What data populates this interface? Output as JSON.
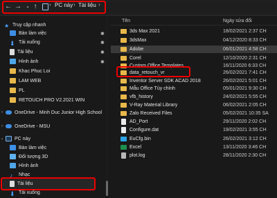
{
  "address": {
    "back_icon": "arrow-left-icon",
    "forward_icon": "arrow-right-icon",
    "recent_icon": "chevron-down-icon",
    "up_icon": "arrow-up-icon",
    "crumbs": [
      "PC này",
      "Tài liệu"
    ]
  },
  "nav": {
    "items": [
      {
        "label": "Truy cập nhanh",
        "icon": "star-icon"
      },
      {
        "label": "Bàn làm việc",
        "icon": "desktop-icon"
      },
      {
        "label": "Tải xuống",
        "icon": "download-icon"
      },
      {
        "label": "Tài liệu",
        "icon": "document-icon"
      },
      {
        "label": "Hình ảnh",
        "icon": "pictures-icon"
      },
      {
        "label": "Khac Phuc Loi",
        "icon": "folder-icon"
      },
      {
        "label": "LAM WEB",
        "icon": "folder-icon"
      },
      {
        "label": "PL",
        "icon": "folder-icon"
      },
      {
        "label": "RETOUCH PRO V2.2021 WIN",
        "icon": "folder-icon"
      },
      {
        "label": "OneDrive - Minh Duc Junior High School",
        "icon": "cloud-icon"
      },
      {
        "label": "OneDrive - MSU",
        "icon": "cloud-icon"
      },
      {
        "label": "PC này",
        "icon": "pc-icon"
      },
      {
        "label": "Bàn làm việc",
        "icon": "desktop-icon"
      },
      {
        "label": "Đối tượng 3D",
        "icon": "cube-icon"
      },
      {
        "label": "Hình ảnh",
        "icon": "pictures-icon"
      },
      {
        "label": "Nhạc",
        "icon": "music-icon"
      },
      {
        "label": "Tài liệu",
        "icon": "document-icon"
      },
      {
        "label": "Tải xuống",
        "icon": "download-icon"
      }
    ]
  },
  "columns": {
    "name": "Tên",
    "date": "Ngày sửa đổi"
  },
  "files": [
    {
      "name": "3ds Max 2021",
      "date": "18/02/2021 2:37 CH"
    },
    {
      "name": "3dsMax",
      "date": "04/12/2020 8:33 CH"
    },
    {
      "name": "Adobe",
      "date": "06/01/2021 4:58 CH"
    },
    {
      "name": "Corel",
      "date": "12/10/2020 2:31 CH"
    },
    {
      "name": "Custom Office Templates",
      "date": "16/11/2020 6:33 CH"
    },
    {
      "name": "data_retouch_vr",
      "date": "26/02/2021 7:41 CH"
    },
    {
      "name": "Inventor Server SDK ACAD 2018",
      "date": "26/02/2021 5:01 CH"
    },
    {
      "name": "Mẫu Office Tùy chỉnh",
      "date": "05/01/2021 9:30 CH"
    },
    {
      "name": "vfb_history",
      "date": "24/02/2021 5:55 CH"
    },
    {
      "name": "V-Ray Material Library",
      "date": "06/02/2021 2:05 CH"
    },
    {
      "name": "Zalo Received Files",
      "date": "05/02/2021 10:35 SA"
    },
    {
      "name": "AD_Port",
      "date": "29/11/2020 2:02 CH"
    },
    {
      "name": "Configure.dat",
      "date": "19/02/2021 3:55 CH"
    },
    {
      "name": "EuCfg.bin",
      "date": "26/02/2021 3:12 CH"
    },
    {
      "name": "Excel",
      "date": "13/11/2020 3:46 CH"
    },
    {
      "name": "plot.log",
      "date": "28/11/2020 2:30 CH"
    }
  ],
  "colors": {
    "accent": "#e00000",
    "folder": "#e8b84a",
    "selected_row": "#3a3a3a"
  }
}
